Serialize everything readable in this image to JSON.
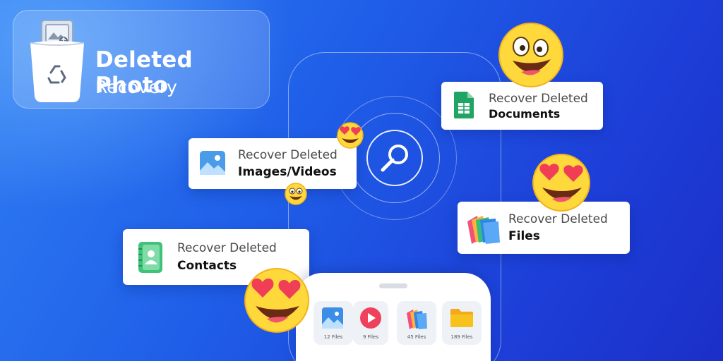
{
  "brand": {
    "title": "Deleted Photo",
    "subtitle": "Recovery"
  },
  "cards": {
    "images": {
      "line1": "Recover Deleted",
      "line2": "Images/Videos",
      "icon": "image-icon"
    },
    "documents": {
      "line1": "Recover Deleted",
      "line2": "Documents",
      "icon": "spreadsheet-icon"
    },
    "files": {
      "line1": "Recover Deleted",
      "line2": "Files",
      "icon": "folders-icon"
    },
    "contacts": {
      "line1": "Recover Deleted",
      "line2": "Contacts",
      "icon": "contact-book-icon"
    }
  },
  "phone": {
    "tiles": [
      {
        "label": "12 Files",
        "icon": "photo-icon"
      },
      {
        "label": "9 Files",
        "icon": "play-icon"
      },
      {
        "label": "45 Files",
        "icon": "stacked-files-icon"
      },
      {
        "label": "189 Files",
        "icon": "folder-icon"
      }
    ]
  },
  "colors": {
    "background_start": "#2f7df3",
    "background_end": "#1b2fc8",
    "sheet_green": "#1fa463",
    "contact_green": "#3fc27a",
    "image_blue": "#3a8ee6",
    "play_red": "#f0415c",
    "folder_yellow": "#f8c21c",
    "emoji_yellow": "#ffd83b"
  }
}
